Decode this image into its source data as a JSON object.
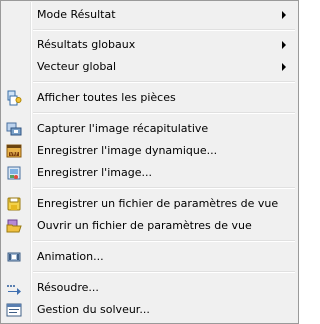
{
  "menu": {
    "items": [
      {
        "label": "Mode Résultat",
        "submenu": true
      },
      {
        "label": "Résultats globaux",
        "submenu": true
      },
      {
        "label": "Vecteur global",
        "submenu": true
      },
      {
        "label": "Afficher toutes les pièces",
        "icon": "show-parts-icon"
      },
      {
        "label": "Capturer l'image récapitulative",
        "icon": "capture-summary-icon"
      },
      {
        "label": "Enregistrer l'image dynamique...",
        "icon": "save-dynamic-image-icon"
      },
      {
        "label": "Enregistrer l'image...",
        "icon": "save-image-icon"
      },
      {
        "label": "Enregistrer un fichier de paramètres de vue",
        "icon": "save-view-params-icon"
      },
      {
        "label": "Ouvrir un fichier de paramètres de vue",
        "icon": "open-view-params-icon"
      },
      {
        "label": "Animation...",
        "icon": "animation-icon"
      },
      {
        "label": "Résoudre...",
        "icon": "solve-icon"
      },
      {
        "label": "Gestion du solveur...",
        "icon": "solver-manager-icon"
      }
    ]
  }
}
